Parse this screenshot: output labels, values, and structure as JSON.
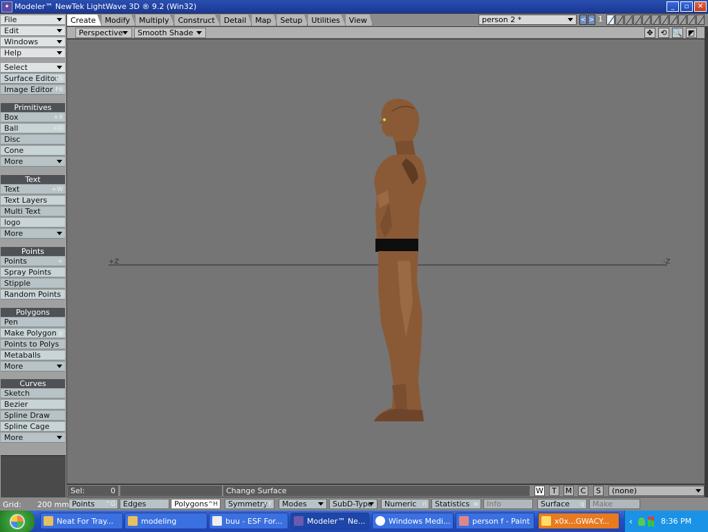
{
  "window": {
    "title": "Modeler™ NewTek LightWave 3D ® 9.2 (Win32)",
    "min": "_",
    "max": "▫",
    "close": "✕"
  },
  "sidebar": {
    "menus": [
      {
        "label": "File"
      },
      {
        "label": "Edit"
      },
      {
        "label": "Windows"
      },
      {
        "label": "Help"
      }
    ],
    "select": {
      "label": "Select"
    },
    "editors": [
      {
        "label": "Surface Editor",
        "shortcut": "F5"
      },
      {
        "label": "Image Editor",
        "shortcut": "F6"
      }
    ],
    "sections": [
      {
        "title": "Primitives",
        "items": [
          {
            "label": "Box",
            "shortcut": "+X"
          },
          {
            "label": "Ball",
            "shortcut": "+O"
          },
          {
            "label": "Disc",
            "shortcut": ""
          },
          {
            "label": "Cone",
            "shortcut": ""
          },
          {
            "label": "More",
            "shortcut": ""
          }
        ]
      },
      {
        "title": "Text",
        "items": [
          {
            "label": "Text",
            "shortcut": "+W"
          },
          {
            "label": "Text Layers",
            "shortcut": ""
          },
          {
            "label": "Multi Text",
            "shortcut": ""
          },
          {
            "label": "logo",
            "shortcut": ""
          },
          {
            "label": "More",
            "shortcut": ""
          }
        ]
      },
      {
        "title": "Points",
        "items": [
          {
            "label": "Points",
            "shortcut": "+"
          },
          {
            "label": "Spray Points",
            "shortcut": ""
          },
          {
            "label": "Stipple",
            "shortcut": ""
          },
          {
            "label": "Random Points",
            "shortcut": ""
          }
        ]
      },
      {
        "title": "Polygons",
        "items": [
          {
            "label": "Pen",
            "shortcut": ""
          },
          {
            "label": "Make Polygon",
            "shortcut": "p"
          },
          {
            "label": "Points to Polys",
            "shortcut": ""
          },
          {
            "label": "Metaballs",
            "shortcut": ""
          },
          {
            "label": "More",
            "shortcut": ""
          }
        ]
      },
      {
        "title": "Curves",
        "items": [
          {
            "label": "Sketch",
            "shortcut": ""
          },
          {
            "label": "Bezier",
            "shortcut": ""
          },
          {
            "label": "Spline Draw",
            "shortcut": ""
          },
          {
            "label": "Spline Cage",
            "shortcut": ""
          },
          {
            "label": "More",
            "shortcut": ""
          }
        ]
      }
    ]
  },
  "tabs": [
    "Create",
    "Modify",
    "Multiply",
    "Construct",
    "Detail",
    "Map",
    "Setup",
    "Utilities",
    "View"
  ],
  "object": {
    "name": "person 2 *",
    "prev": "<",
    "next": ">",
    "layer_number": "1"
  },
  "viewport": {
    "view": "Perspective",
    "shading": "Smooth Shade",
    "axis_left": "+Z",
    "axis_right": "-Z",
    "icons": [
      "✥",
      "⟲",
      "🔍",
      "◩"
    ]
  },
  "status": {
    "sel_label": "Sel:",
    "sel_value": "0",
    "hint": "Change Surface",
    "wtmcs": [
      "W",
      "T",
      "M",
      "C",
      "S"
    ],
    "surface_select": "(none)"
  },
  "bottombar": {
    "grid_label": "Grid:",
    "grid_value": "200 mm",
    "points": "Points",
    "points_sc": "^G",
    "edges": "Edges",
    "polygons": "Polygons",
    "polygons_sc": "^H",
    "symmetry": "Symmetry",
    "symmetry_sc": "+Y",
    "modes": "Modes",
    "subd": "SubD-Type",
    "numeric": "Numeric",
    "numeric_sc": "n",
    "statistics": "Statistics",
    "statistics_sc": "w",
    "info": "Info",
    "surface": "Surface",
    "surface_sc": "q",
    "make": "Make"
  },
  "taskbar": {
    "tasks": [
      "Neat For Tray...",
      "modeling",
      "buu - ESF For...",
      "Modeler™ Ne...",
      "Windows Medi...",
      "person f - Paint",
      "x0x...GWACY..."
    ],
    "clock": "8:36 PM"
  },
  "colors": {
    "viewport_bg": "#757575",
    "skin": "#8a5a36",
    "belt": "#0e0e0e"
  }
}
